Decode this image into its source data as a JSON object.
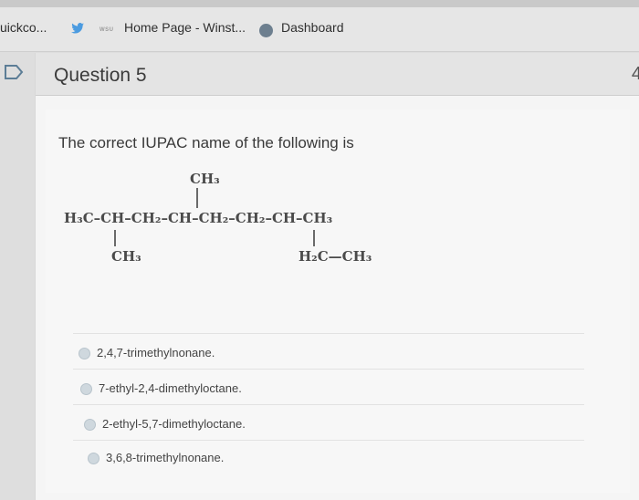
{
  "bookmarks": {
    "item1": "uickco...",
    "item2_badge": "WSU",
    "item2": "Home Page - Winst...",
    "item3": "Dashboard"
  },
  "question": {
    "title": "Question 5",
    "points": "4",
    "prompt": "The correct IUPAC name of the following is"
  },
  "structure": {
    "top_branch": "CH₃",
    "main_chain": "H₃C–CH–CH₂–CH–CH₂–CH₂–CH–CH₃",
    "left_branch": "CH₃",
    "right_branch": "H₂C—CH₃"
  },
  "options": [
    "2,4,7-trimethylnonane.",
    "7-ethyl-2,4-dimethyloctane.",
    "2-ethyl-5,7-dimethyloctane.",
    "3,6,8-trimethylnonane."
  ]
}
